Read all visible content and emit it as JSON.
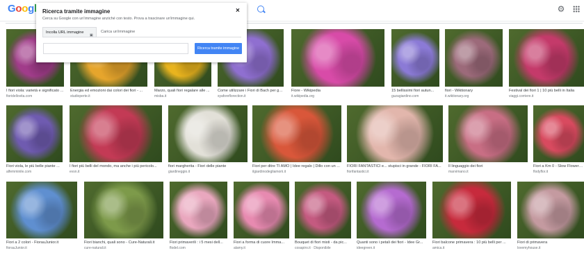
{
  "header": {
    "logo_letters": [
      "G",
      "o",
      "o",
      "g",
      "l",
      "e"
    ],
    "icons": [
      "search-icon",
      "gear-icon",
      "apps-icon"
    ]
  },
  "dialog": {
    "title": "Ricerca tramite immagine",
    "subtitle": "Cerca su Google con un'immagine anziché con testo. Prova a trascinare un'immagine qui.",
    "close_label": "×",
    "tab_url": "Incolla URL immagine",
    "tab_upload": "Carica un'immagine",
    "url_value": "",
    "url_placeholder": "",
    "search_button": "Ricerca tramite immagine"
  },
  "results": [
    {
      "caption": "I fiori viola: varietà e significato ...",
      "source": "fioridellovita.com",
      "color": "#a13c8a"
    },
    {
      "caption": "Energia ed emozioni dai colori dei fiori - ...",
      "source": "studioperte.it",
      "color": "#e6a52c"
    },
    {
      "caption": "Marzo, quali fiori regalare alle ...",
      "source": "misba.it",
      "color": "#e9b41e"
    },
    {
      "caption": "Come utilizzare i Fiori di Bach per gestire ...",
      "source": "syaforeflorection.it",
      "color": "#8f6fd0"
    },
    {
      "caption": "Fiore - Wikipedia",
      "source": "it.wikipedia.org",
      "color": "#d84ba8"
    },
    {
      "caption": "15 bellissimi fiori autun...",
      "source": "guzagiardino.com",
      "color": "#8b7ad6"
    },
    {
      "caption": "fiori - Wiktionary",
      "source": "it.wiktionary.org",
      "color": "#9c6a7a"
    },
    {
      "caption": "Festival dei fiori 1 | 10 più belli in Italia",
      "source": "viaggi.corriere.it",
      "color": "#c43a6a"
    },
    {
      "caption": "Fiori viola, le più belle piante ...",
      "source": "alfemminile.com",
      "color": "#6f5bb0"
    },
    {
      "caption": "I fiori più belli del mondo, ma anche i più pericolo...",
      "source": "evsn.it",
      "color": "#c33a55"
    },
    {
      "caption": "fiori margherita - Fiori delle piante",
      "source": "giardineggio.it",
      "color": "#e2e0d8"
    },
    {
      "caption": "Fiori per ditre TI AMO | Idee regalo | Dillo con un ...",
      "source": "ilgiardinodegliamorii.it",
      "color": "#d9573a"
    },
    {
      "caption": "FIORI FANTASTICI e... stupisci in grande - FIORI FA...",
      "source": "fiorifantastici.it",
      "color": "#e2b6ac"
    },
    {
      "caption": "Il linguaggio dei fiori",
      "source": "marvimano.it",
      "color": "#c86e84"
    },
    {
      "caption": "Fiori a Km 0 - Slow Flowers | ...",
      "source": "flodyflor.it",
      "color": "#d84a5f"
    },
    {
      "caption": "Fiori a 2 colori - FiorauJunior.it",
      "source": "fiorauJunior.it",
      "color": "#5f8fd0"
    },
    {
      "caption": "Fiori bianchi, quali sono - Cure-Naturali.it",
      "source": "cure-naturali.it",
      "color": "#7d9a4a"
    },
    {
      "caption": "Fiori primaverili : i 5 mesi dell...",
      "source": "flodel.com",
      "color": "#e9a7be"
    },
    {
      "caption": "Fiori a forma di cuore Imma...",
      "source": "alamy.it",
      "color": "#e78ab0"
    },
    {
      "caption": "Bouquet di fiori misti - da pic...",
      "source": "cosapiro.it · Disponibile",
      "color": "#c45a80"
    },
    {
      "caption": "Quanti sono i petali dei fiori - Idee Gr...",
      "source": "ideegreen.it",
      "color": "#b56bd0"
    },
    {
      "caption": "Fiori balcone primavera : 10 più belli per ...",
      "source": "amica.it",
      "color": "#c72a3c"
    },
    {
      "caption": "Fiori di primavera",
      "source": "lovemyhouse.it",
      "color": "#c49aa0"
    }
  ]
}
